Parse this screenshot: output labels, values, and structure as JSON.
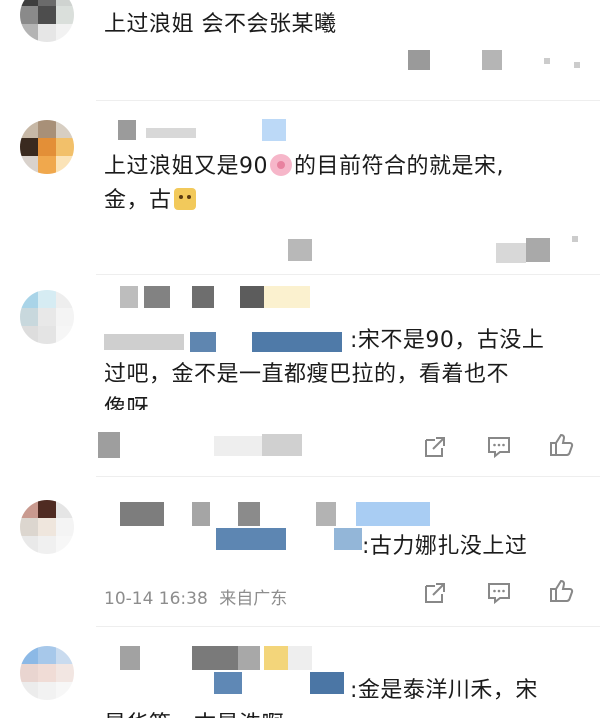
{
  "comments": [
    {
      "text": "上过浪姐 会不会张某曦"
    },
    {
      "text_line1_a": "上过浪姐又是90",
      "text_line1_b": "的目前符合的就是宋,",
      "text_line2": "金，古",
      "emoji_1": "cherry-blossom",
      "emoji_2": "dog-face"
    },
    {
      "reply_prefix": ":",
      "text_line1": "宋不是90，古没上",
      "text_line2": "过吧，金不是一直都瘦巴拉的，看着也不",
      "text_line3": "像呀"
    },
    {
      "reply_prefix": ":",
      "text": "古力娜扎没上过",
      "timestamp": "10-14 16:38",
      "location": "来自广东"
    },
    {
      "reply_prefix": ":",
      "text_line1": "金是泰洋川禾，宋",
      "text_line2": "是华策，古是浩啊"
    }
  ],
  "icons": [
    "share-icon",
    "comment-icon",
    "like-icon"
  ],
  "colors": {
    "text": "#1b1b1b",
    "meta": "#8d8d8d",
    "icon": "#888888"
  }
}
